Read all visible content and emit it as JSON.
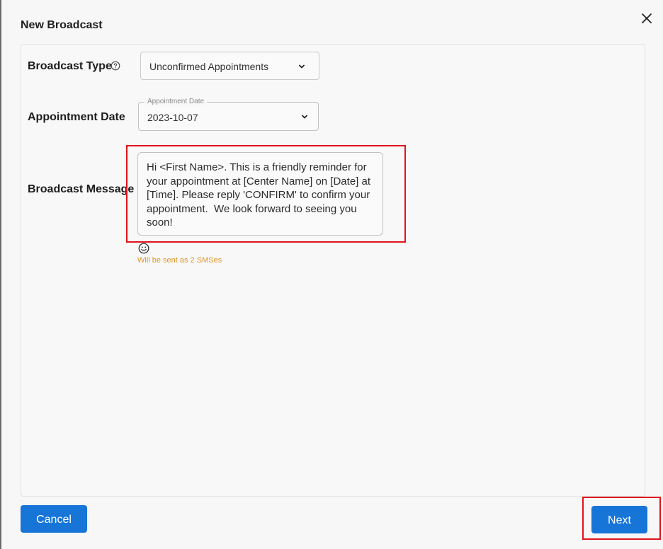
{
  "dialog": {
    "title": "New Broadcast"
  },
  "form": {
    "broadcast_type": {
      "label": "Broadcast Type",
      "value": "Unconfirmed Appointments"
    },
    "appointment_date": {
      "label": "Appointment Date",
      "legend": "Appointment Date",
      "value": "2023-10-07"
    },
    "broadcast_message": {
      "label": "Broadcast Message",
      "value": "Hi <First Name>. This is a friendly reminder for your appointment at [Center Name] on [Date] at [Time]. Please reply 'CONFIRM' to confirm your appointment.  We look forward to seeing you soon!",
      "sms_note": "Will be sent as 2 SMSes"
    }
  },
  "footer": {
    "cancel_label": "Cancel",
    "next_label": "Next"
  },
  "icons": {
    "close": "close-icon",
    "help": "help-icon",
    "chevron": "chevron-down-icon",
    "emoji": "smiley-icon"
  },
  "colors": {
    "primary": "#1775d8",
    "highlight": "#e0141c",
    "note": "#e0962a"
  }
}
